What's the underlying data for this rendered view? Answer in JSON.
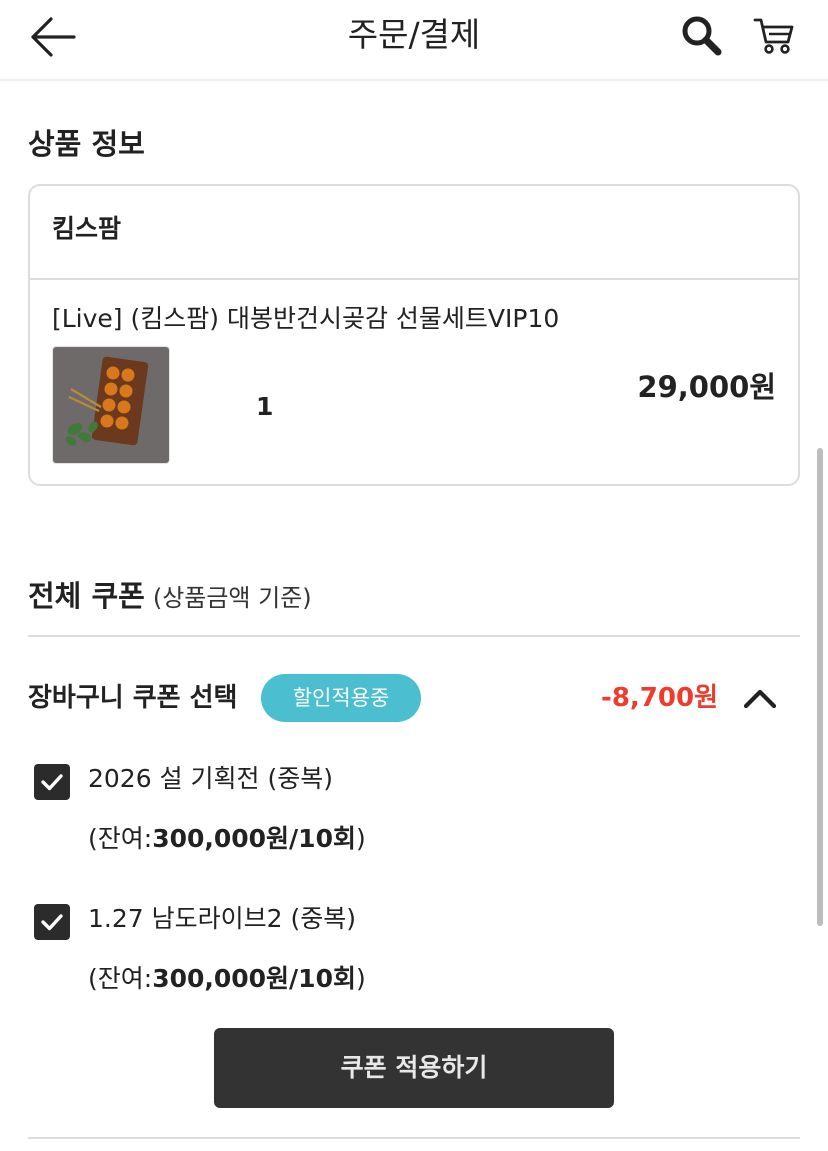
{
  "header": {
    "title": "주문/결제",
    "back_icon": "arrow-left-icon",
    "search_icon": "search-icon",
    "cart_icon": "cart-icon"
  },
  "product_section": {
    "title": "상품 정보",
    "seller": "킴스팜",
    "product_name": "[Live] (킴스팜) 대봉반건시곶감 선물세트VIP10",
    "quantity": "1",
    "price": "29,000원"
  },
  "coupon_section": {
    "title": "전체 쿠폰",
    "subtitle": "(상품금액 기준)",
    "cart_coupon_label": "장바구니 쿠폰 선택",
    "badge": "할인적용중",
    "discount_amount": "-8,700원",
    "coupons": [
      {
        "name": "2026 설 기획전 (중복)",
        "remain_prefix": "(잔여:",
        "remain_value": "300,000원/10회",
        "remain_suffix": ")",
        "checked": true
      },
      {
        "name": "1.27 남도라이브2 (중복)",
        "remain_prefix": "(잔여:",
        "remain_value": "300,000원/10회",
        "remain_suffix": ")",
        "checked": true
      }
    ],
    "apply_button": "쿠폰 적용하기"
  },
  "colors": {
    "accent_badge": "#4bbecf",
    "discount_red": "#ee3b2b",
    "dark_button": "#333333"
  }
}
